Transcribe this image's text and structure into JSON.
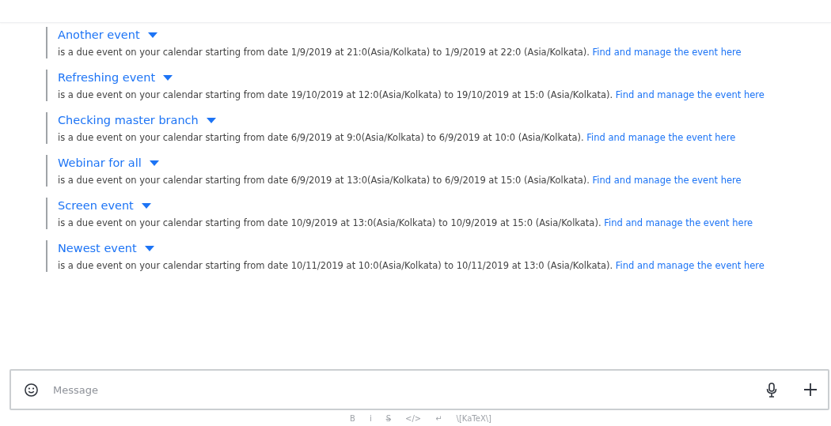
{
  "events": [
    {
      "title": "Another event",
      "text": "is a due event on your calendar starting from date 1/9/2019 at 21:0(Asia/Kolkata) to 1/9/2019 at 22:0 (Asia/Kolkata).",
      "link": "Find and manage the event here"
    },
    {
      "title": "Refreshing event",
      "text": "is a due event on your calendar starting from date 19/10/2019 at 12:0(Asia/Kolkata) to 19/10/2019 at 15:0 (Asia/Kolkata).",
      "link": "Find and manage the event here"
    },
    {
      "title": "Checking master branch",
      "text": "is a due event on your calendar starting from date 6/9/2019 at 9:0(Asia/Kolkata) to 6/9/2019 at 10:0 (Asia/Kolkata).",
      "link": "Find and manage the event here"
    },
    {
      "title": "Webinar for all",
      "text": "is a due event on your calendar starting from date 6/9/2019 at 13:0(Asia/Kolkata) to 6/9/2019 at 15:0 (Asia/Kolkata).",
      "link": "Find and manage the event here"
    },
    {
      "title": "Screen event",
      "text": "is a due event on your calendar starting from date 10/9/2019 at 13:0(Asia/Kolkata) to 10/9/2019 at 15:0 (Asia/Kolkata).",
      "link": "Find and manage the event here"
    },
    {
      "title": "Newest event",
      "text": "is a due event on your calendar starting from date 10/11/2019 at 10:0(Asia/Kolkata) to 10/11/2019 at 13:0 (Asia/Kolkata).",
      "link": "Find and manage the event here"
    }
  ],
  "composer": {
    "placeholder": "Message"
  },
  "format_tools": [
    {
      "kind": "bold",
      "label": "B"
    },
    {
      "kind": "italic",
      "label": "i"
    },
    {
      "kind": "strike",
      "label": "S"
    },
    {
      "kind": "code",
      "label": "</>"
    },
    {
      "kind": "newline",
      "label": "↵"
    },
    {
      "kind": "katex",
      "label": "\\[KaTeX\\]"
    }
  ]
}
